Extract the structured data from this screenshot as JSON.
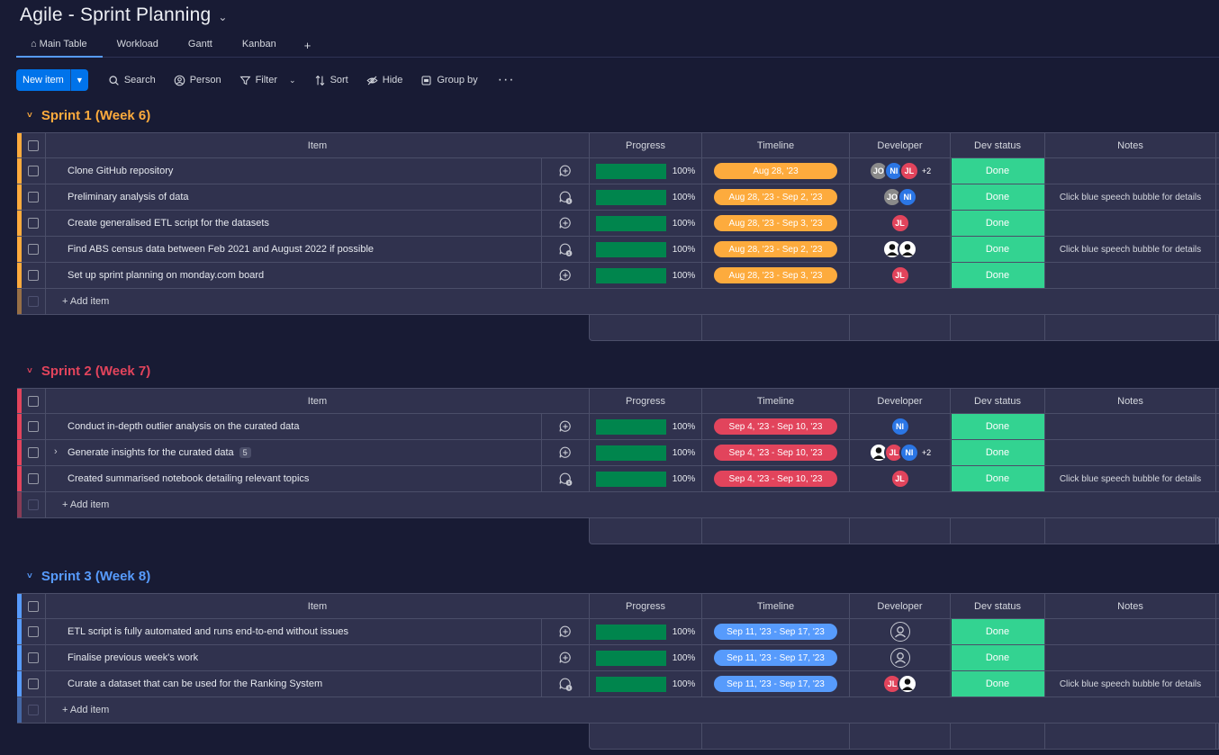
{
  "board": {
    "title": "Agile - Sprint Planning"
  },
  "tabs": [
    {
      "label": "Main Table"
    },
    {
      "label": "Workload"
    },
    {
      "label": "Gantt"
    },
    {
      "label": "Kanban"
    }
  ],
  "toolbar": {
    "new_item": "New item",
    "search": "Search",
    "person": "Person",
    "filter": "Filter",
    "sort": "Sort",
    "hide": "Hide",
    "group_by": "Group by"
  },
  "columns": {
    "item": "Item",
    "progress": "Progress",
    "timeline": "Timeline",
    "developer": "Developer",
    "dev_status": "Dev status",
    "notes": "Notes"
  },
  "add_item_label": "+ Add item",
  "colors": {
    "sprint1": "#fdab3d",
    "sprint2": "#e2445c",
    "sprint3": "#579bfc",
    "done": "#33d391",
    "progress": "#00854d"
  },
  "groups": [
    {
      "title": "Sprint 1 (Week 6)",
      "color": "#fdab3d",
      "items": [
        {
          "name": "Clone GitHub repository",
          "progress": "100%",
          "timeline": "Aug 28, '23",
          "status": "Done",
          "notes": "",
          "devs": [
            "JO",
            "NI",
            "JL"
          ],
          "more": "+2",
          "conv": "add"
        },
        {
          "name": "Preliminary analysis of data",
          "progress": "100%",
          "timeline": "Aug 28, '23 - Sep 2, '23",
          "status": "Done",
          "notes": "Click blue speech bubble for details",
          "devs": [
            "JO",
            "NI"
          ],
          "more": "",
          "conv": "1"
        },
        {
          "name": "Create generalised ETL script for the datasets",
          "progress": "100%",
          "timeline": "Aug 28, '23 - Sep 3, '23",
          "status": "Done",
          "notes": "",
          "devs": [
            "JL"
          ],
          "more": "",
          "conv": "add"
        },
        {
          "name": "Find ABS census data between Feb 2021 and August 2022 if possible",
          "progress": "100%",
          "timeline": "Aug 28, '23 - Sep 2, '23",
          "status": "Done",
          "notes": "Click blue speech bubble for details",
          "devs": [
            "PH",
            "PH"
          ],
          "more": "",
          "conv": "1"
        },
        {
          "name": "Set up sprint planning on monday.com board",
          "progress": "100%",
          "timeline": "Aug 28, '23 - Sep 3, '23",
          "status": "Done",
          "notes": "",
          "devs": [
            "JL"
          ],
          "more": "",
          "conv": "add"
        }
      ]
    },
    {
      "title": "Sprint 2 (Week 7)",
      "color": "#e2445c",
      "items": [
        {
          "name": "Conduct in-depth outlier analysis on the curated data",
          "progress": "100%",
          "timeline": "Sep 4, '23 - Sep 10, '23",
          "status": "Done",
          "notes": "",
          "devs": [
            "NI"
          ],
          "more": "",
          "conv": "add"
        },
        {
          "name": "Generate insights for the curated data",
          "sub": "5",
          "progress": "100%",
          "timeline": "Sep 4, '23 - Sep 10, '23",
          "status": "Done",
          "notes": "",
          "devs": [
            "PH",
            "JL",
            "NI"
          ],
          "more": "+2",
          "conv": "add"
        },
        {
          "name": "Created summarised notebook detailing relevant topics",
          "progress": "100%",
          "timeline": "Sep 4, '23 - Sep 10, '23",
          "status": "Done",
          "notes": "Click blue speech bubble for details",
          "devs": [
            "JL"
          ],
          "more": "",
          "conv": "1"
        }
      ]
    },
    {
      "title": "Sprint 3 (Week 8)",
      "color": "#579bfc",
      "items": [
        {
          "name": "ETL script is fully automated and runs end-to-end without issues",
          "progress": "100%",
          "timeline": "Sep 11, '23 - Sep 17, '23",
          "status": "Done",
          "notes": "",
          "devs": [
            "EMPTY"
          ],
          "more": "",
          "conv": "add"
        },
        {
          "name": "Finalise previous week's work",
          "progress": "100%",
          "timeline": "Sep 11, '23 - Sep 17, '23",
          "status": "Done",
          "notes": "",
          "devs": [
            "EMPTY"
          ],
          "more": "",
          "conv": "add"
        },
        {
          "name": "Curate a dataset that can be used for the Ranking System",
          "progress": "100%",
          "timeline": "Sep 11, '23 - Sep 17, '23",
          "status": "Done",
          "notes": "Click blue speech bubble for details",
          "devs": [
            "JL",
            "PH"
          ],
          "more": "",
          "conv": "1"
        }
      ]
    }
  ]
}
